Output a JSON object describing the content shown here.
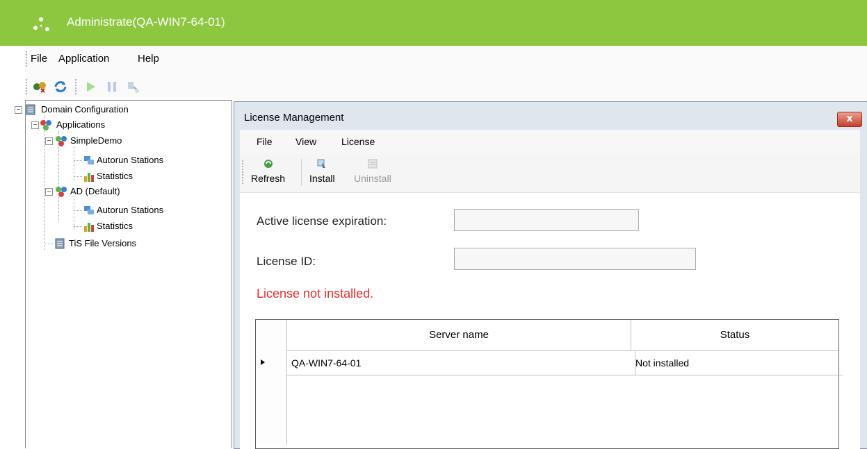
{
  "window": {
    "title": "Administrate(QA-WIN7-64-01)",
    "accent": "#8dc63f"
  },
  "menu": {
    "file": "File",
    "application": "Application",
    "help": "Help"
  },
  "toolbar": {
    "icons": [
      "add-icon",
      "refresh-icon",
      "play-icon",
      "pause-icon",
      "stop-icon"
    ]
  },
  "tree": {
    "domain": "Domain Configuration",
    "applications": "Applications",
    "simpledemo": "SimpleDemo",
    "simpledemo_autorun": "Autorun Stations",
    "simpledemo_stats": "Statistics",
    "ad": "AD (Default)",
    "ad_autorun": "Autorun Stations",
    "ad_stats": "Statistics",
    "tis": "TiS File Versions"
  },
  "dialog": {
    "title": "License Management",
    "close": "x",
    "menu": {
      "file": "File",
      "view": "View",
      "license": "License"
    },
    "toolbar": {
      "refresh": "Refresh",
      "install": "Install",
      "uninstall": "Uninstall"
    },
    "fields": {
      "expiration_label": "Active license expiration:",
      "expiration_value": "",
      "id_label": "License ID:",
      "id_value": ""
    },
    "status_message": "License not installed.",
    "warning_color": "#ef2b2b",
    "grid": {
      "columns": [
        "Server name",
        "Status"
      ],
      "rows": [
        {
          "server": "QA-WIN7-64-01",
          "status": "Not installed"
        }
      ]
    }
  }
}
